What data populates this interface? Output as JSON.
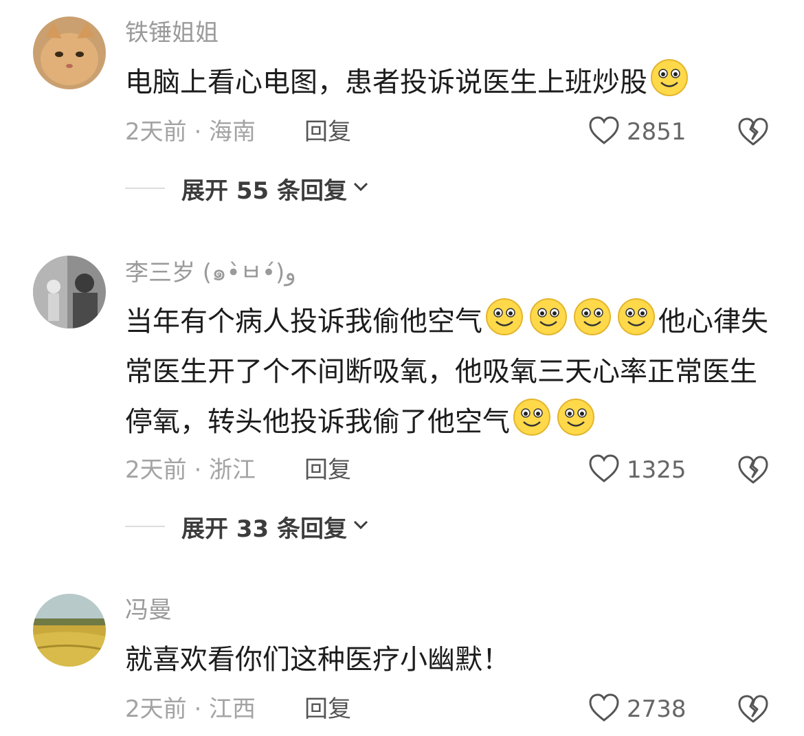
{
  "comments": [
    {
      "username": "铁锤姐姐",
      "text": "电脑上看心电图，患者投诉说医生上班炒股",
      "meta": "2天前 · 海南",
      "reply_label": "回复",
      "likes": "2851",
      "expand_label": "展开 55 条回复",
      "avatar_icon": "cat-avatar-icon"
    },
    {
      "username": "李三岁 (๑•̀ㅂ•́)و",
      "text_part1": "当年有个病人投诉我偷他空气",
      "text_part2": "他心律失常医生开了个不间断吸氧，他吸氧三天心率正常医生停氧，转头他投诉我偷了他空气",
      "meta": "2天前 · 浙江",
      "reply_label": "回复",
      "likes": "1325",
      "expand_label": "展开 33 条回复",
      "avatar_icon": "photo-avatar-icon"
    },
    {
      "username": "冯曼",
      "text": "就喜欢看你们这种医疗小幽默！",
      "meta": "2天前 · 江西",
      "reply_label": "回复",
      "likes": "2738",
      "avatar_icon": "field-avatar-icon"
    }
  ],
  "colors": {
    "emoji_face": "#FFD94A",
    "username": "#9a9a9a",
    "text": "#1c1c1c"
  }
}
